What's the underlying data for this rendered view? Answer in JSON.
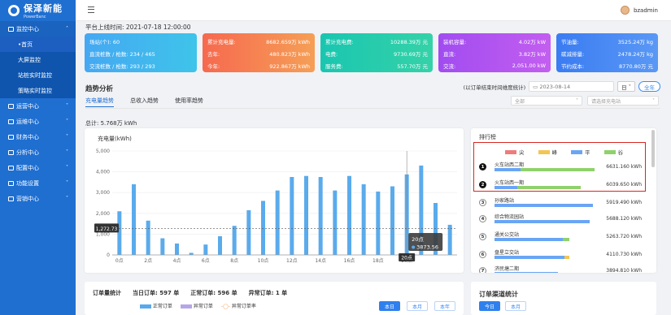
{
  "brand": {
    "name": "保泽新能",
    "sub": "PowerBanc"
  },
  "sidebar": {
    "items": [
      {
        "label": "监控中心",
        "open": true
      },
      {
        "label": "运营中心"
      },
      {
        "label": "运维中心"
      },
      {
        "label": "财务中心"
      },
      {
        "label": "分析中心"
      },
      {
        "label": "配置中心"
      },
      {
        "label": "功能设置"
      },
      {
        "label": "营销中心"
      }
    ],
    "sub": [
      "首页",
      "大屏监控",
      "站桩实时监控",
      "策略实时监控"
    ]
  },
  "user": {
    "name": "bzadmin"
  },
  "online": "平台上线时间: 2021-07-18 12:00:00",
  "cards": [
    {
      "rows": [
        [
          "场站(个): 60",
          ""
        ],
        [
          "直流桩数 / 枪数: 234 / 465",
          ""
        ],
        [
          "交流桩数 / 枪数: 293 / 293",
          ""
        ]
      ]
    },
    {
      "rows": [
        [
          "累计充电量:",
          "8682.659万 kWh"
        ],
        [
          "去年:",
          "480.823万 kWh"
        ],
        [
          "今年:",
          "922.867万 kWh"
        ]
      ]
    },
    {
      "rows": [
        [
          "累计充电费:",
          "10288.39万 元"
        ],
        [
          "电费:",
          "9730.69万 元"
        ],
        [
          "服务费:",
          "557.70万 元"
        ]
      ]
    },
    {
      "rows": [
        [
          "装机容量:",
          "4.02万 kW"
        ],
        [
          "直流:",
          "3.82万 kW"
        ],
        [
          "交流:",
          "2,051.00 kW"
        ]
      ]
    },
    {
      "rows": [
        [
          "节油量:",
          "3525.24万 kg"
        ],
        [
          "碳减排量:",
          "2478.24万 kg"
        ],
        [
          "节约成本:",
          "8770.80万 元"
        ]
      ]
    }
  ],
  "section": {
    "title": "趋势分析",
    "stat_note": "(以订单结束时间维度统计)",
    "date": "2023-08-14",
    "day_btn": "日",
    "all_btn": "全年"
  },
  "tabs": [
    "充电量趋势",
    "总收入趋势",
    "使用率趋势"
  ],
  "selects": {
    "s1": "全部",
    "s2": "请选择充电站"
  },
  "total": "总计: 5.768万 kWh",
  "chart_data": {
    "type": "bar",
    "title": "充电量(kWh)",
    "categories": [
      "0点",
      "1点",
      "2点",
      "3点",
      "4点",
      "5点",
      "6点",
      "7点",
      "8点",
      "9点",
      "10点",
      "11点",
      "12点",
      "13点",
      "14点",
      "15点",
      "16点",
      "17点",
      "18点",
      "19点",
      "20点",
      "21点",
      "22点",
      "23点"
    ],
    "values": [
      2100,
      3400,
      1650,
      800,
      550,
      100,
      500,
      900,
      1400,
      2150,
      2600,
      3100,
      3750,
      3800,
      3750,
      3100,
      3800,
      3400,
      3050,
      3300,
      3873.56,
      4300,
      2500,
      1450
    ],
    "ylim": [
      0,
      5000
    ],
    "yticks": [
      0,
      1000,
      2000,
      3000,
      4000,
      5000
    ],
    "ytick_labels": [
      "0",
      "1,000",
      "2,000",
      "3,000",
      "4,000",
      "5,000"
    ],
    "xtick_labels": [
      "0点",
      "2点",
      "4点",
      "6点",
      "8点",
      "10点",
      "12点",
      "14点",
      "16点",
      "18点",
      "20点"
    ],
    "avg_label": "1,272.73",
    "avg_value": 1272.73,
    "tooltip": {
      "category": "20点",
      "value": "3873.56"
    }
  },
  "rank": {
    "title": "排行榜",
    "legend": [
      {
        "label": "尖",
        "color": "#ef7b7b"
      },
      {
        "label": "峰",
        "color": "#f3c553"
      },
      {
        "label": "平",
        "color": "#6aa5f5"
      },
      {
        "label": "谷",
        "color": "#8fd16b"
      }
    ],
    "items": [
      {
        "n": "1",
        "name": "火车站西二期",
        "value": "6631.160 kWh",
        "ping": 0.25,
        "gu": 0.73
      },
      {
        "n": "2",
        "name": "火车站西一期",
        "value": "6039.650 kWh",
        "ping": 0.22,
        "gu": 0.62
      },
      {
        "n": "3",
        "name": "孙家路站",
        "value": "5919.490 kWh",
        "ping": 0.96,
        "gu": 0
      },
      {
        "n": "4",
        "name": "综合物流园站",
        "value": "5688.120 kWh",
        "ping": 0.93,
        "gu": 0
      },
      {
        "n": "5",
        "name": "通关公交站",
        "value": "5263.720 kWh",
        "ping": 0.67,
        "gu": 0.06
      },
      {
        "n": "6",
        "name": "盘星立交站",
        "value": "4110.730 kWh",
        "ping": 0.68,
        "feng": 0.05
      },
      {
        "n": "7",
        "name": "济民塘二期",
        "value": "3894.810 kWh",
        "ping": 0.62,
        "gu": 0
      }
    ]
  },
  "orders": {
    "title": "订单量统计",
    "today": "当日订单: 597 单",
    "normal": "正常订单: 596 单",
    "abnormal": "异常订单: 1 单",
    "legend": [
      "正常订单",
      "异常订单",
      "异常订单率"
    ],
    "btns": [
      "本日",
      "本月",
      "本年"
    ]
  },
  "channel": {
    "title": "订单渠道统计",
    "btns": [
      "今日",
      "本月"
    ]
  }
}
